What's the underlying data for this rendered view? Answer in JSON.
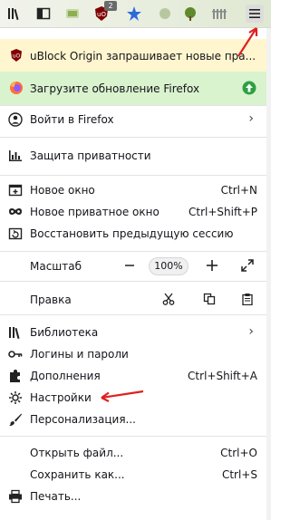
{
  "toolbar": {
    "badge_count": "2",
    "icons": [
      "library-icon",
      "sidebar-icon",
      "ublock-icon",
      "extension-icon",
      "dots-icon",
      "hamburger-menu-icon"
    ]
  },
  "banners": {
    "ublock": "uBlock Origin запрашивает новые пра...",
    "update": "Загрузите обновление Firefox"
  },
  "menu": {
    "signin": "Войти в Firefox",
    "privacy": "Защита приватности",
    "new_window": "Новое окно",
    "new_window_shortcut": "Ctrl+N",
    "private_window": "Новое приватное окно",
    "private_window_shortcut": "Ctrl+Shift+P",
    "restore_session": "Восстановить предыдущую сессию",
    "zoom_label": "Масштаб",
    "zoom_value": "100%",
    "edit_label": "Правка",
    "library": "Библиотека",
    "logins": "Логины и пароли",
    "addons": "Дополнения",
    "addons_shortcut": "Ctrl+Shift+A",
    "settings": "Настройки",
    "customize": "Персонализация...",
    "open_file": "Открыть файл...",
    "open_file_shortcut": "Ctrl+O",
    "save_as": "Сохранить как...",
    "save_as_shortcut": "Ctrl+S",
    "print": "Печать..."
  },
  "colors": {
    "ublock_banner_bg": "#fff6cf",
    "update_banner_bg": "#d9f3ce",
    "annotation_arrow": "#e02020"
  }
}
